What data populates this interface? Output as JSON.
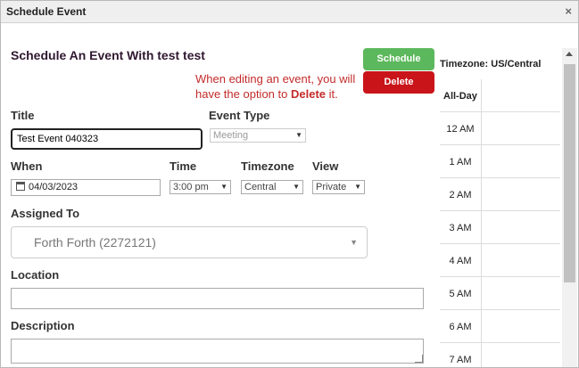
{
  "dialog": {
    "title": "Schedule Event",
    "close_glyph": "×"
  },
  "form": {
    "heading": "Schedule An Event With test test",
    "note_pre": "When editing an event, you will have the option to ",
    "note_bold": "Delete",
    "note_post": " it.",
    "schedule_label": "Schedule",
    "delete_label": "Delete",
    "title_label": "Title",
    "title_value": "Test Event 040323",
    "event_type_label": "Event Type",
    "event_type_value": "Meeting",
    "when_label": "When",
    "when_value": "04/03/2023",
    "time_label": "Time",
    "time_value": "3:00 pm",
    "timezone_label": "Timezone",
    "timezone_value": "Central",
    "view_label": "View",
    "view_value": "Private",
    "assigned_label": "Assigned To",
    "assigned_value": "Forth Forth (2272121)",
    "location_label": "Location",
    "location_value": "",
    "description_label": "Description",
    "description_value": ""
  },
  "calendar": {
    "timezone_text": "Timezone: US/Central",
    "allday_label": "All-Day",
    "hours": [
      "12 AM",
      "1 AM",
      "2 AM",
      "3 AM",
      "4 AM",
      "5 AM",
      "6 AM",
      "7 AM"
    ]
  },
  "colors": {
    "schedule": "#5cb85c",
    "delete": "#c9151a",
    "note": "#c42b2b",
    "heading": "#301830"
  },
  "icons": {
    "close": "close-icon",
    "calendar": "calendar-icon",
    "dropdown": "chevron-down-icon"
  }
}
